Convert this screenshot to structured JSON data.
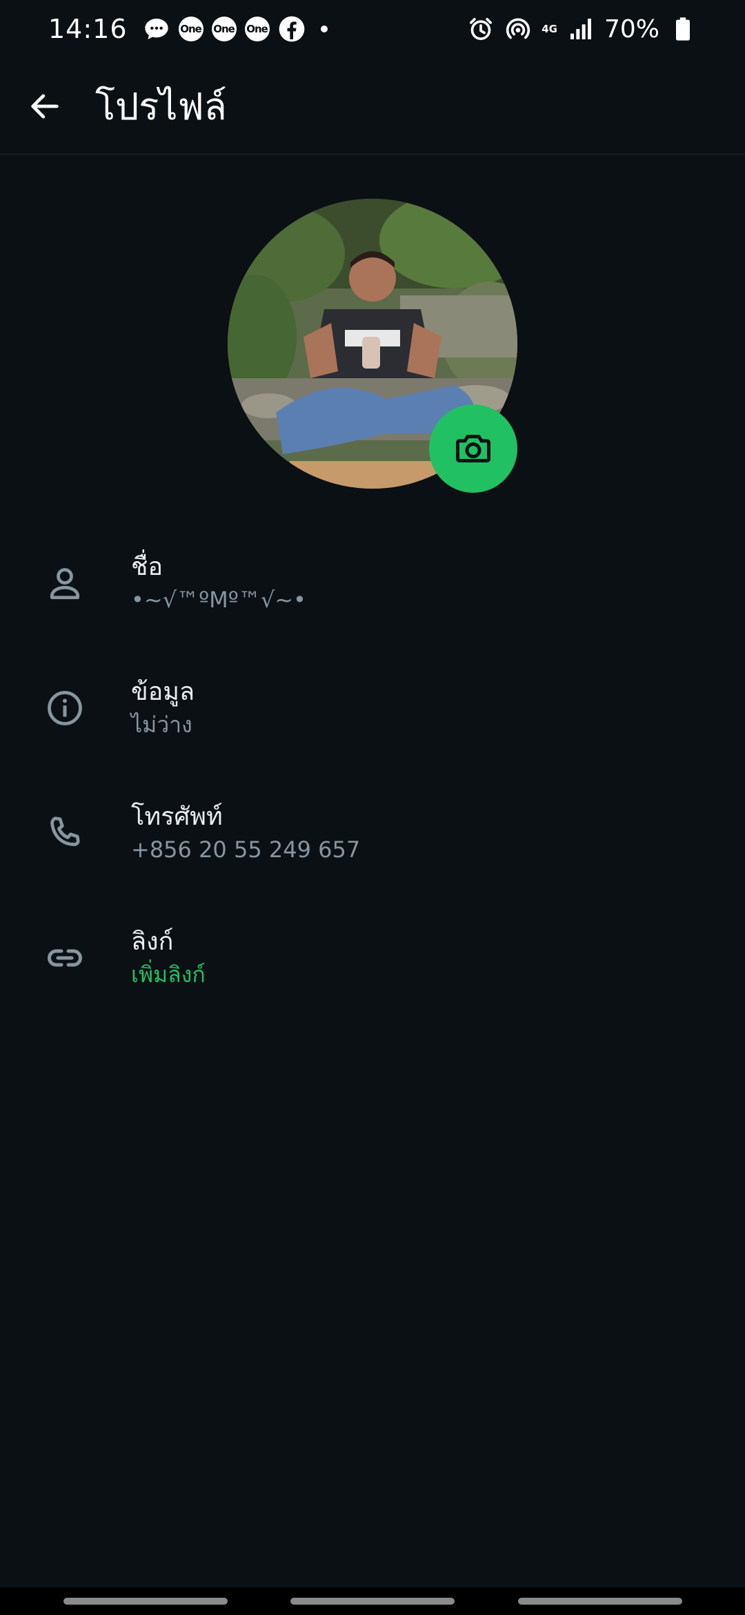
{
  "status_bar": {
    "time": "14:16",
    "notification_icons": [
      "chat-bubble-icon",
      "one-app-icon",
      "one-app-icon",
      "one-app-icon",
      "facebook-icon"
    ],
    "one_badge": "One",
    "network": "4G",
    "battery": "70%"
  },
  "header": {
    "title": "โปรไฟล์"
  },
  "profile": {
    "rows": [
      {
        "label": "ชื่อ",
        "value": "•~√™ºMº™√~•",
        "icon": "person-icon"
      },
      {
        "label": "ข้อมูล",
        "value": "ไม่ว่าง",
        "icon": "info-icon"
      },
      {
        "label": "โทรศัพท์",
        "value": "+856 20 55 249 657",
        "icon": "phone-icon"
      },
      {
        "label": "ลิงก์",
        "value": "เพิ่มลิงก์",
        "icon": "link-icon"
      }
    ]
  },
  "colors": {
    "background": "#0b1014",
    "accent": "#21c063",
    "secondary_text": "#8696a0",
    "icon": "#8696a0"
  }
}
